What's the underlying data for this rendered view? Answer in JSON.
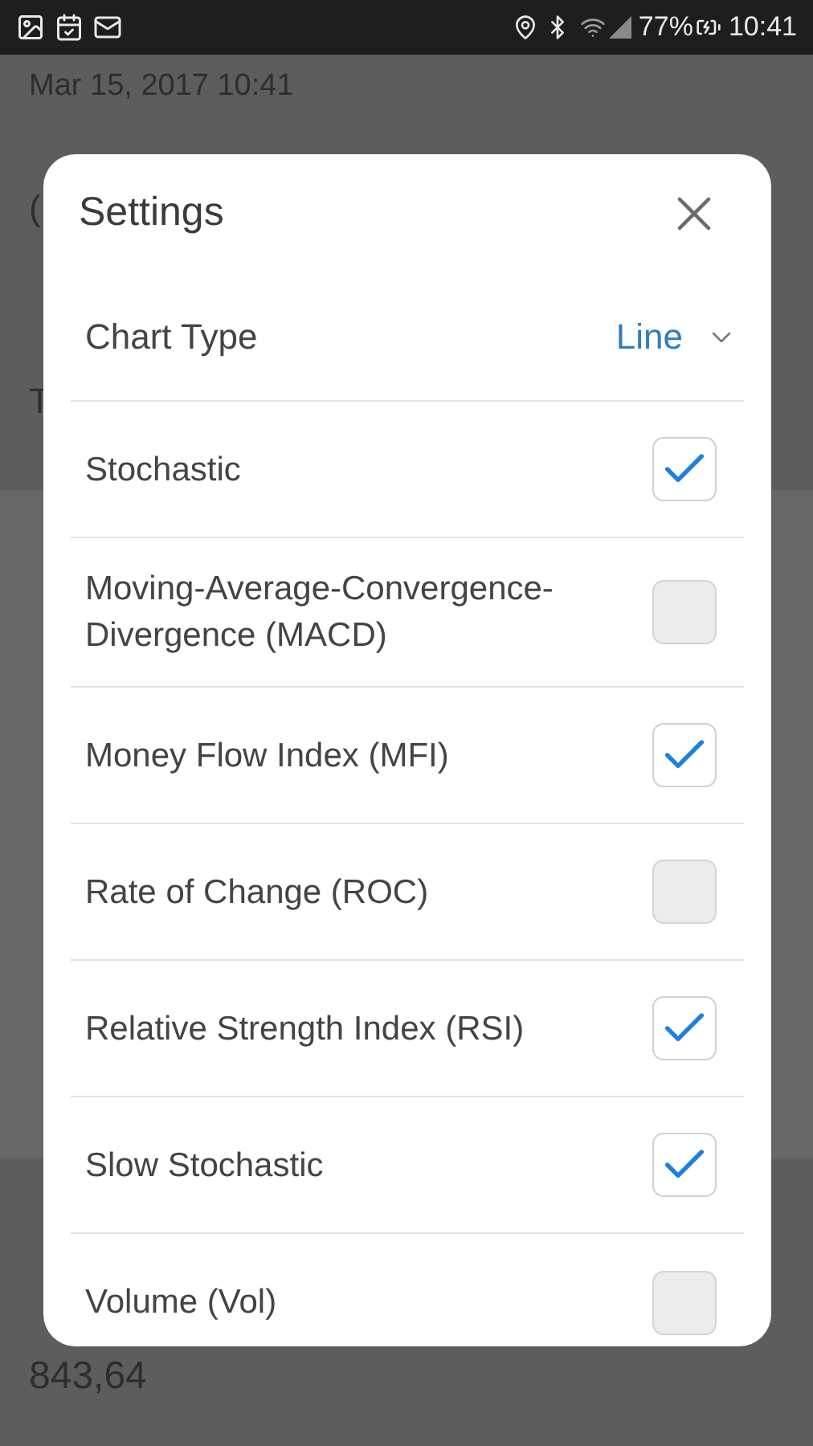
{
  "status_bar": {
    "battery": "77%",
    "time": "10:41"
  },
  "background": {
    "date": "Mar 15, 2017 10:41",
    "fragments": [
      "(",
      "T"
    ],
    "value": "843,64"
  },
  "dialog": {
    "title": "Settings",
    "chart_type": {
      "label": "Chart Type",
      "value": "Line"
    },
    "options": [
      {
        "label": "Stochastic",
        "checked": true
      },
      {
        "label": "Moving-Average-Convergence-Divergence (MACD)",
        "checked": false
      },
      {
        "label": "Money Flow Index (MFI)",
        "checked": true
      },
      {
        "label": "Rate of Change (ROC)",
        "checked": false
      },
      {
        "label": "Relative Strength Index (RSI)",
        "checked": true
      },
      {
        "label": "Slow Stochastic",
        "checked": true
      },
      {
        "label": "Volume (Vol)",
        "checked": false
      }
    ]
  }
}
